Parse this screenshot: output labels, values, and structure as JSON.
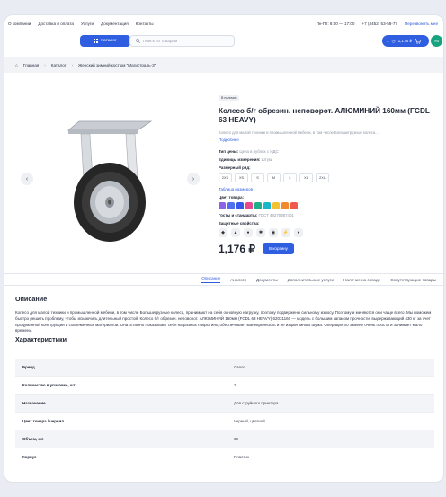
{
  "topbar": {
    "links": [
      "О компании",
      "Доставка и оплата",
      "Услуги",
      "Документация",
      "Контакты"
    ],
    "hours": "Пн-Пт: 8:00 — 17:00",
    "phone": "+7 (3452) 53-58-77",
    "callback": "Перезвонить мне"
  },
  "header": {
    "catalog_label": "Каталог",
    "search_placeholder": "Поиск по товарам",
    "cart_count": "1",
    "cart_total": "1,176 ₽",
    "avatar_initials": "УВ"
  },
  "breadcrumb": [
    "Главная",
    "Каталог",
    "Женский зимний костюм \"Магистраль-3\""
  ],
  "product": {
    "badge": "В наличии",
    "title": "Колесо б/г обрезин. неповорот. АЛЮМИНИЙ 160мм (FCDL 63 HEAVY)",
    "short_desc": "Колесо для малой техники и промышленной мебели, в том числе Большегрузные колеса...",
    "more_link": "Подробнее",
    "price_type_label": "Тип цены:",
    "price_type_value": "Цена в рублях с НДС",
    "unit_label": "Единицы измерения:",
    "unit_value": "Штуки",
    "size_label": "Размерный ряд:",
    "sizes": [
      "2XS",
      "XS",
      "S",
      "M",
      "L",
      "XL",
      "2XL"
    ],
    "size_table_link": "Таблица размеров",
    "color_label": "Цвет товара:",
    "colors": [
      "#8a63e8",
      "#4f6ff0",
      "#3657e8",
      "#e64a8c",
      "#1fae8a",
      "#18b6c9",
      "#f2c230",
      "#f08a2c",
      "#ef5a4a"
    ],
    "gost_label": "Госты и стандарты:",
    "gost_value": "ГОСТ 48270387401",
    "props_label": "Защитные свойства:",
    "props_icons": [
      "shield-icon",
      "flame-icon",
      "drop-icon",
      "cold-icon",
      "dust-icon",
      "shock-icon",
      "acid-icon"
    ],
    "price": "1,176 ₽",
    "buy_label": "В корзину"
  },
  "tabs": [
    "Описание",
    "Аналоги",
    "Документы",
    "Дополнительные услуги",
    "Наличие на складе",
    "Сопутствующие товары"
  ],
  "description": {
    "title": "Описание",
    "text": "Колесо для малой техники и промышленной мебели, в том числе Большегрузные колеса, принимают на себя основную нагрузку, поэтому подвержены сильному износу. Поэтому и меняются они чаще всего. Мы поможем быстро решить проблему, чтобы исключить длительный простой. Колесо б/г обрезин. неповорот. АЛЮМИНИЙ 160мм (FCDL 63 HEAVY) 62031160 — модель с большим запасом прочности, выдерживающий 430 кг за счет продуманной конструкции и современных материалов. Она отлично показывает себя на разных покрытиях, обеспечивает маневренность и не издает много шума. Операция по замене очень проста и занимает мало времени."
  },
  "specs": {
    "title": "Характеристики",
    "rows": [
      {
        "k": "Бренд",
        "v": "Canon"
      },
      {
        "k": "Количество в упаковке, шт",
        "v": "2"
      },
      {
        "k": "Назначение",
        "v": "Для струйного принтера"
      },
      {
        "k": "Цвет тонера / чернил",
        "v": "Черный, цветной"
      },
      {
        "k": "Объем, мл",
        "v": "38"
      },
      {
        "k": "Корпус",
        "v": "Пластик"
      }
    ]
  }
}
